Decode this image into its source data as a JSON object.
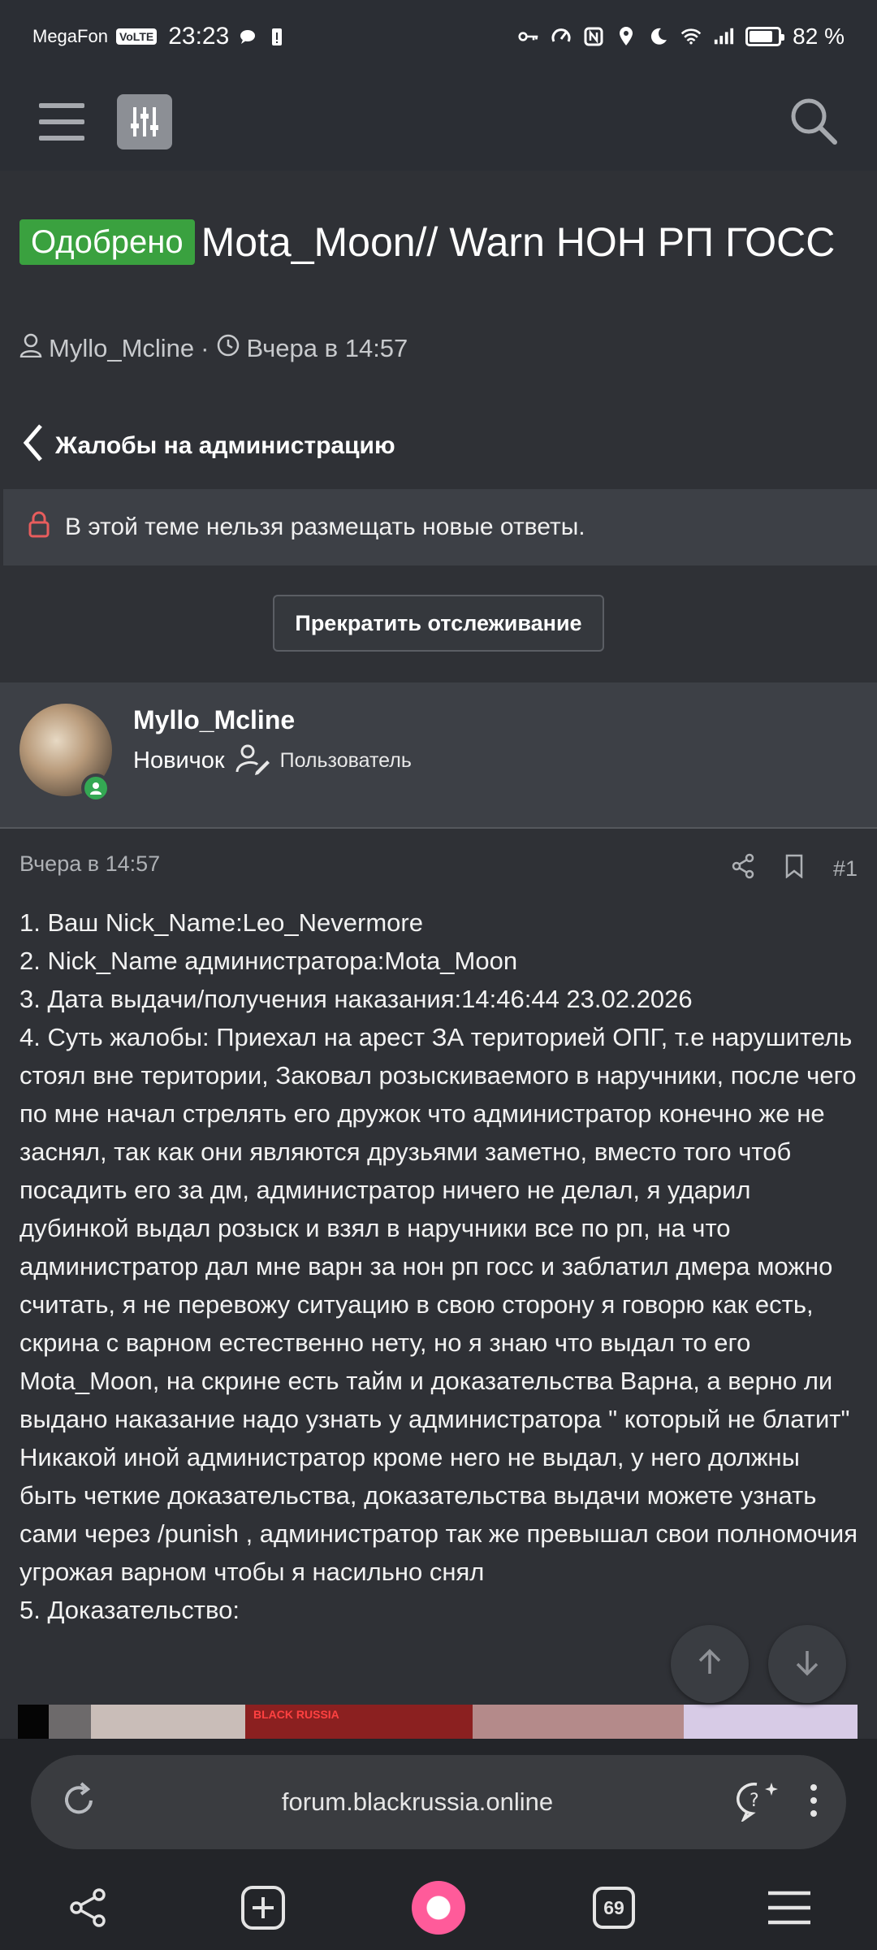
{
  "status_bar": {
    "carrier": "MegaFon",
    "volte": "VoLTE",
    "time": "23:23",
    "battery_percent_text": "82 %",
    "battery_level": 0.82
  },
  "header": {
    "menu_icon": "hamburger-menu-icon",
    "filter_icon": "filter-sliders-icon",
    "search_icon": "search-icon"
  },
  "thread": {
    "badge": "Одобрено",
    "title": "Mota_Moon// Warn НОН РП ГОСС",
    "author": "Myllo_Mcline",
    "separator": "·",
    "date": "Вчера в 14:57",
    "back_label": "Жалобы на администрацию",
    "locked_notice": "В этой теме нельзя размещать новые ответы.",
    "unwatch_button": "Прекратить отслеживание"
  },
  "post": {
    "user": {
      "name": "Myllo_Mcline",
      "rank": "Новичок",
      "group": "Пользователь"
    },
    "date": "Вчера в 14:57",
    "number": "#1",
    "lines": [
      "1. Ваш Nick_Name:Leo_Nevermore",
      "2. Nick_Name администратора:Mota_Moon",
      "3. Дата выдачи/получения наказания:14:46:44 23.02.2026",
      "4. Суть жалобы: Приехал на арест ЗА територией ОПГ, т.е нарушитель стоял вне територии, Заковал розыскиваемого в наручники, после чего по мне начал стрелять его дружок что администратор конечно же не заснял, так как они являются друзьями заметно, вместо того чтоб посадить его за дм, администратор ничего не делал, я ударил дубинкой выдал розыск и взял в наручники все по рп, на что администратор дал мне варн за нон рп госс и заблатил дмера можно считать, я не перевожу ситуацию в свою сторону я говорю как есть, скрина с варном естественно нету, но я знаю что выдал то его Mota_Moon, на скрине есть тайм и доказательства Варна, а верно ли выдано наказание надо узнать у администратора \" который не блатит\" Никакой иной администратор кроме него не выдал, у него должны быть четкие доказательства, доказательства выдачи можете узнать сами через /punish , администратор так же превышал свои полномочия угрожая варном чтобы я насильно снял",
      "5. Доказательство:"
    ]
  },
  "browser": {
    "url": "forum.blackrussia.online",
    "tabs_count": "69"
  }
}
